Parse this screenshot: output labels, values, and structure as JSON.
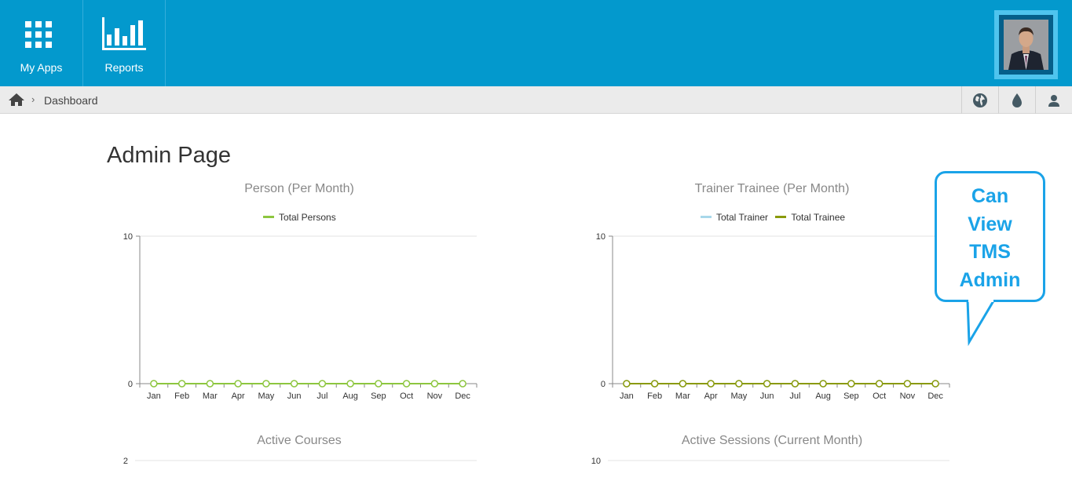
{
  "topbar": {
    "nav": [
      {
        "label": "My Apps",
        "icon": "apps-grid-icon"
      },
      {
        "label": "Reports",
        "icon": "bar-chart-icon"
      }
    ],
    "avatar": "user-avatar"
  },
  "breadcrumb": {
    "home_icon": "home-icon",
    "separator": "›",
    "current": "Dashboard",
    "tools": [
      "globe-icon",
      "drop-icon",
      "user-icon"
    ]
  },
  "page": {
    "title": "Admin Page"
  },
  "callout": {
    "lines": [
      "Can",
      "View",
      "TMS",
      "Admin"
    ],
    "color": "#1aa3e8"
  },
  "colors": {
    "topbar": "#0399cd",
    "total_persons": "#8dc63f",
    "total_trainer": "#a8d8ea",
    "total_trainee": "#8a9a0b"
  },
  "chart_data": [
    {
      "type": "line",
      "title": "Person (Per Month)",
      "categories": [
        "Jan",
        "Feb",
        "Mar",
        "Apr",
        "May",
        "Jun",
        "Jul",
        "Aug",
        "Sep",
        "Oct",
        "Nov",
        "Dec"
      ],
      "series": [
        {
          "name": "Total Persons",
          "color": "#8dc63f",
          "values": [
            0,
            0,
            0,
            0,
            0,
            0,
            0,
            0,
            0,
            0,
            0,
            0
          ]
        }
      ],
      "ylim": [
        0,
        10
      ],
      "yticks": [
        "0",
        "10"
      ],
      "legend": "top"
    },
    {
      "type": "line",
      "title": "Trainer Trainee (Per Month)",
      "categories": [
        "Jan",
        "Feb",
        "Mar",
        "Apr",
        "May",
        "Jun",
        "Jul",
        "Aug",
        "Sep",
        "Oct",
        "Nov",
        "Dec"
      ],
      "series": [
        {
          "name": "Total Trainer",
          "color": "#a8d8ea",
          "values": [
            0,
            0,
            0,
            0,
            0,
            0,
            0,
            0,
            0,
            0,
            0,
            0
          ]
        },
        {
          "name": "Total Trainee",
          "color": "#8a9a0b",
          "values": [
            0,
            0,
            0,
            0,
            0,
            0,
            0,
            0,
            0,
            0,
            0,
            0
          ]
        }
      ],
      "ylim": [
        0,
        10
      ],
      "yticks": [
        "0",
        "10"
      ],
      "legend": "top"
    },
    {
      "type": "bar",
      "title": "Active Courses",
      "yticks": [
        "2"
      ]
    },
    {
      "type": "bar",
      "title": "Active Sessions (Current Month)",
      "yticks": [
        "10"
      ]
    }
  ]
}
